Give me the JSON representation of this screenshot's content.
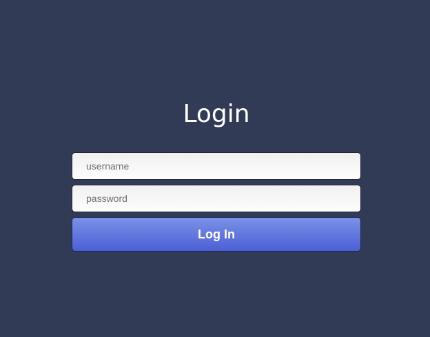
{
  "login": {
    "title": "Login",
    "username_placeholder": "username",
    "username_value": "",
    "password_placeholder": "password",
    "password_value": "",
    "submit_label": "Log In"
  },
  "colors": {
    "background": "#323b56",
    "button_top": "#7a92e6",
    "button_bottom": "#4c5fd6",
    "title_text": "#ffffff"
  }
}
